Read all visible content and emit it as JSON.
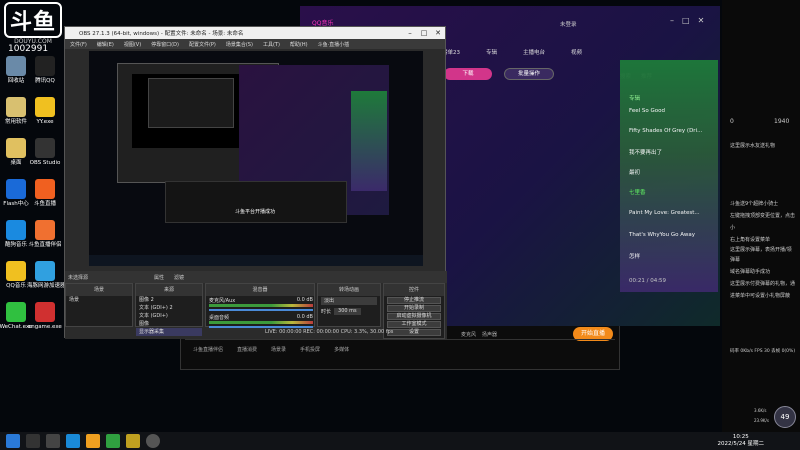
{
  "watermark": {
    "logo": "斗鱼",
    "sub": "DOUYU.COM",
    "room_id": "1002991"
  },
  "desktop_icons": [
    {
      "label": "回收站",
      "color": "#6a8aa8"
    },
    {
      "label": "腾讯QQ",
      "color": "#222"
    },
    {
      "label": "常用软件",
      "color": "#d8c070"
    },
    {
      "label": "YY.exe",
      "color": "#f0c020"
    },
    {
      "label": "桌面",
      "color": "#e0c060"
    },
    {
      "label": "OBS Studio",
      "color": "#333"
    },
    {
      "label": "Flash中心",
      "color": "#1a6ad8"
    },
    {
      "label": "斗鱼直播",
      "color": "#f06020"
    },
    {
      "label": "酷狗音乐",
      "color": "#1a8ae0"
    },
    {
      "label": "斗鱼直播伴侣",
      "color": "#f07030"
    },
    {
      "label": "QQ音乐",
      "color": "#f0c020"
    },
    {
      "label": "海豚网游加速器5.0",
      "color": "#30a0e0"
    },
    {
      "label": "WeChat.exe",
      "color": "#30c040"
    },
    {
      "label": "cngame.exe",
      "color": "#d03030"
    }
  ],
  "obs": {
    "title": "OBS 27.1.3 (64-bit, windows) - 配置文件: 未命名 - 场景: 未命名",
    "menu": [
      "文件(F)",
      "编辑(E)",
      "视图(V)",
      "停靠窗口(D)",
      "配置文件(P)",
      "场景集合(S)",
      "工具(T)",
      "帮助(H)",
      "斗鱼·直播小插"
    ],
    "bar_labels": [
      "未选择源",
      "属性",
      "滤镜"
    ],
    "scenes_title": "场景",
    "scenes": [
      "场景"
    ],
    "sources_title": "来源",
    "sources": [
      "图像 2",
      "文本 (GDI+) 2",
      "文本 (GDI+)",
      "图像",
      "显示器采集"
    ],
    "mixer_title": "混音器",
    "mixer": [
      {
        "name": "麦克风/Aux",
        "db": "0.0 dB"
      },
      {
        "name": "桌面音频",
        "db": "0.0 dB"
      }
    ],
    "transition_title": "转场动画",
    "transition": "淡出",
    "duration_label": "时长",
    "duration": "300 ms",
    "controls_title": "控件",
    "controls": [
      "停止推流",
      "开始录制",
      "启动虚拟摄像机",
      "工作室模式",
      "设置",
      "退出"
    ],
    "status": "LIVE: 00:00:00   REC: 00:00:00   CPU: 3.3%, 30.00 fps"
  },
  "preview": {
    "toast": "斗鱼平台开播成功"
  },
  "music": {
    "app_name": "QQ音乐",
    "user": "未登录",
    "tabs": [
      "榜单23",
      "专辑",
      "主播电台",
      "视频"
    ],
    "download_label": "下载",
    "batch_label": "批量操作",
    "playlist_tabs": [
      "搜索",
      "推荐"
    ],
    "playlist_header": "专辑",
    "playlist": [
      "Feel So Good",
      "Fifty Shades Of Grey (Dri...",
      "我不要再出了",
      "最初",
      "七里香",
      "Paint My Love: Greatest...",
      "That's WhyYou Go Away",
      "怎样"
    ],
    "time": "00:21 / 04:59"
  },
  "companion": {
    "footer": [
      "斗鱼直播伴侣",
      "直播消费",
      "场景录",
      "手机投屏",
      "多媒体"
    ],
    "start_button": "开始直播",
    "mic_label": "麦克风",
    "speaker_label": "扬声器"
  },
  "chat": {
    "likes": "0",
    "count": "1940",
    "lines": [
      "这里展示水友送礼物",
      "斗鱼送9个超牌小骑士",
      "左键拖拽顶部变更位置，点击",
      "小",
      "右上角有设置菜单",
      "这里展示弹幕，表扬开播/领",
      "弹幕",
      "域名弹幕助手成功",
      "这里展示付费弹幕的礼物，通",
      "进菜单中可设置小礼物屏蔽"
    ],
    "footer": "码率 0Kb/s FPS 30 丢帧 0(0%)"
  },
  "system": {
    "time": "10:25",
    "date": "2022/5/24 星期二",
    "net_up": "3.6K/s",
    "net_down": "23.9K/s",
    "cpu_badge": "49"
  }
}
